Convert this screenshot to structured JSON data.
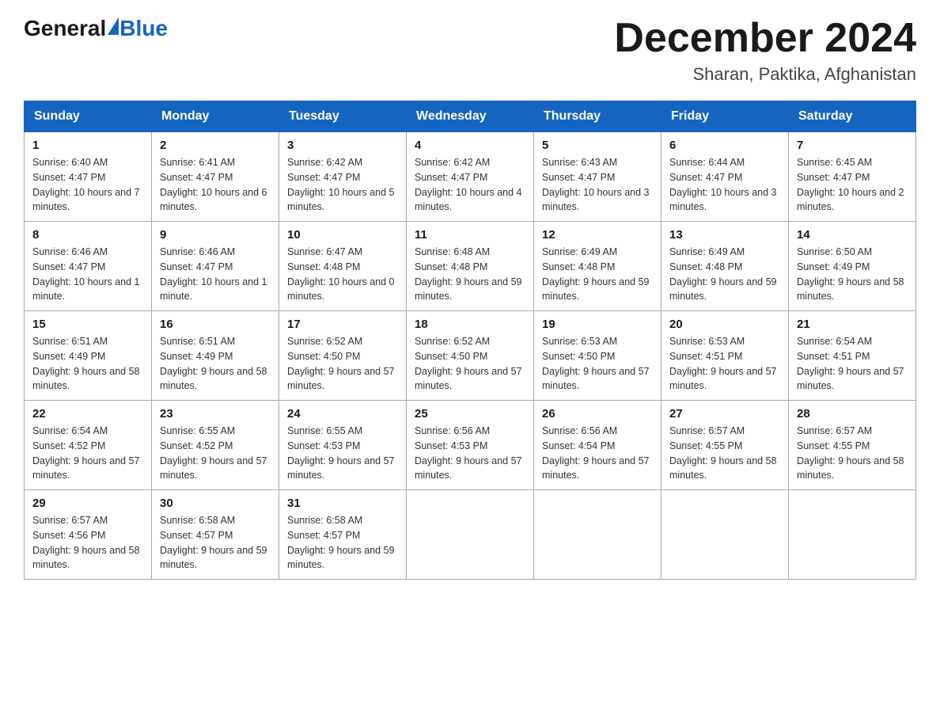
{
  "header": {
    "logo_general": "General",
    "logo_blue": "Blue",
    "month_title": "December 2024",
    "location": "Sharan, Paktika, Afghanistan"
  },
  "calendar": {
    "days_of_week": [
      "Sunday",
      "Monday",
      "Tuesday",
      "Wednesday",
      "Thursday",
      "Friday",
      "Saturday"
    ],
    "weeks": [
      [
        {
          "day": "1",
          "sunrise": "6:40 AM",
          "sunset": "4:47 PM",
          "daylight": "10 hours and 7 minutes."
        },
        {
          "day": "2",
          "sunrise": "6:41 AM",
          "sunset": "4:47 PM",
          "daylight": "10 hours and 6 minutes."
        },
        {
          "day": "3",
          "sunrise": "6:42 AM",
          "sunset": "4:47 PM",
          "daylight": "10 hours and 5 minutes."
        },
        {
          "day": "4",
          "sunrise": "6:42 AM",
          "sunset": "4:47 PM",
          "daylight": "10 hours and 4 minutes."
        },
        {
          "day": "5",
          "sunrise": "6:43 AM",
          "sunset": "4:47 PM",
          "daylight": "10 hours and 3 minutes."
        },
        {
          "day": "6",
          "sunrise": "6:44 AM",
          "sunset": "4:47 PM",
          "daylight": "10 hours and 3 minutes."
        },
        {
          "day": "7",
          "sunrise": "6:45 AM",
          "sunset": "4:47 PM",
          "daylight": "10 hours and 2 minutes."
        }
      ],
      [
        {
          "day": "8",
          "sunrise": "6:46 AM",
          "sunset": "4:47 PM",
          "daylight": "10 hours and 1 minute."
        },
        {
          "day": "9",
          "sunrise": "6:46 AM",
          "sunset": "4:47 PM",
          "daylight": "10 hours and 1 minute."
        },
        {
          "day": "10",
          "sunrise": "6:47 AM",
          "sunset": "4:48 PM",
          "daylight": "10 hours and 0 minutes."
        },
        {
          "day": "11",
          "sunrise": "6:48 AM",
          "sunset": "4:48 PM",
          "daylight": "9 hours and 59 minutes."
        },
        {
          "day": "12",
          "sunrise": "6:49 AM",
          "sunset": "4:48 PM",
          "daylight": "9 hours and 59 minutes."
        },
        {
          "day": "13",
          "sunrise": "6:49 AM",
          "sunset": "4:48 PM",
          "daylight": "9 hours and 59 minutes."
        },
        {
          "day": "14",
          "sunrise": "6:50 AM",
          "sunset": "4:49 PM",
          "daylight": "9 hours and 58 minutes."
        }
      ],
      [
        {
          "day": "15",
          "sunrise": "6:51 AM",
          "sunset": "4:49 PM",
          "daylight": "9 hours and 58 minutes."
        },
        {
          "day": "16",
          "sunrise": "6:51 AM",
          "sunset": "4:49 PM",
          "daylight": "9 hours and 58 minutes."
        },
        {
          "day": "17",
          "sunrise": "6:52 AM",
          "sunset": "4:50 PM",
          "daylight": "9 hours and 57 minutes."
        },
        {
          "day": "18",
          "sunrise": "6:52 AM",
          "sunset": "4:50 PM",
          "daylight": "9 hours and 57 minutes."
        },
        {
          "day": "19",
          "sunrise": "6:53 AM",
          "sunset": "4:50 PM",
          "daylight": "9 hours and 57 minutes."
        },
        {
          "day": "20",
          "sunrise": "6:53 AM",
          "sunset": "4:51 PM",
          "daylight": "9 hours and 57 minutes."
        },
        {
          "day": "21",
          "sunrise": "6:54 AM",
          "sunset": "4:51 PM",
          "daylight": "9 hours and 57 minutes."
        }
      ],
      [
        {
          "day": "22",
          "sunrise": "6:54 AM",
          "sunset": "4:52 PM",
          "daylight": "9 hours and 57 minutes."
        },
        {
          "day": "23",
          "sunrise": "6:55 AM",
          "sunset": "4:52 PM",
          "daylight": "9 hours and 57 minutes."
        },
        {
          "day": "24",
          "sunrise": "6:55 AM",
          "sunset": "4:53 PM",
          "daylight": "9 hours and 57 minutes."
        },
        {
          "day": "25",
          "sunrise": "6:56 AM",
          "sunset": "4:53 PM",
          "daylight": "9 hours and 57 minutes."
        },
        {
          "day": "26",
          "sunrise": "6:56 AM",
          "sunset": "4:54 PM",
          "daylight": "9 hours and 57 minutes."
        },
        {
          "day": "27",
          "sunrise": "6:57 AM",
          "sunset": "4:55 PM",
          "daylight": "9 hours and 58 minutes."
        },
        {
          "day": "28",
          "sunrise": "6:57 AM",
          "sunset": "4:55 PM",
          "daylight": "9 hours and 58 minutes."
        }
      ],
      [
        {
          "day": "29",
          "sunrise": "6:57 AM",
          "sunset": "4:56 PM",
          "daylight": "9 hours and 58 minutes."
        },
        {
          "day": "30",
          "sunrise": "6:58 AM",
          "sunset": "4:57 PM",
          "daylight": "9 hours and 59 minutes."
        },
        {
          "day": "31",
          "sunrise": "6:58 AM",
          "sunset": "4:57 PM",
          "daylight": "9 hours and 59 minutes."
        },
        null,
        null,
        null,
        null
      ]
    ]
  }
}
